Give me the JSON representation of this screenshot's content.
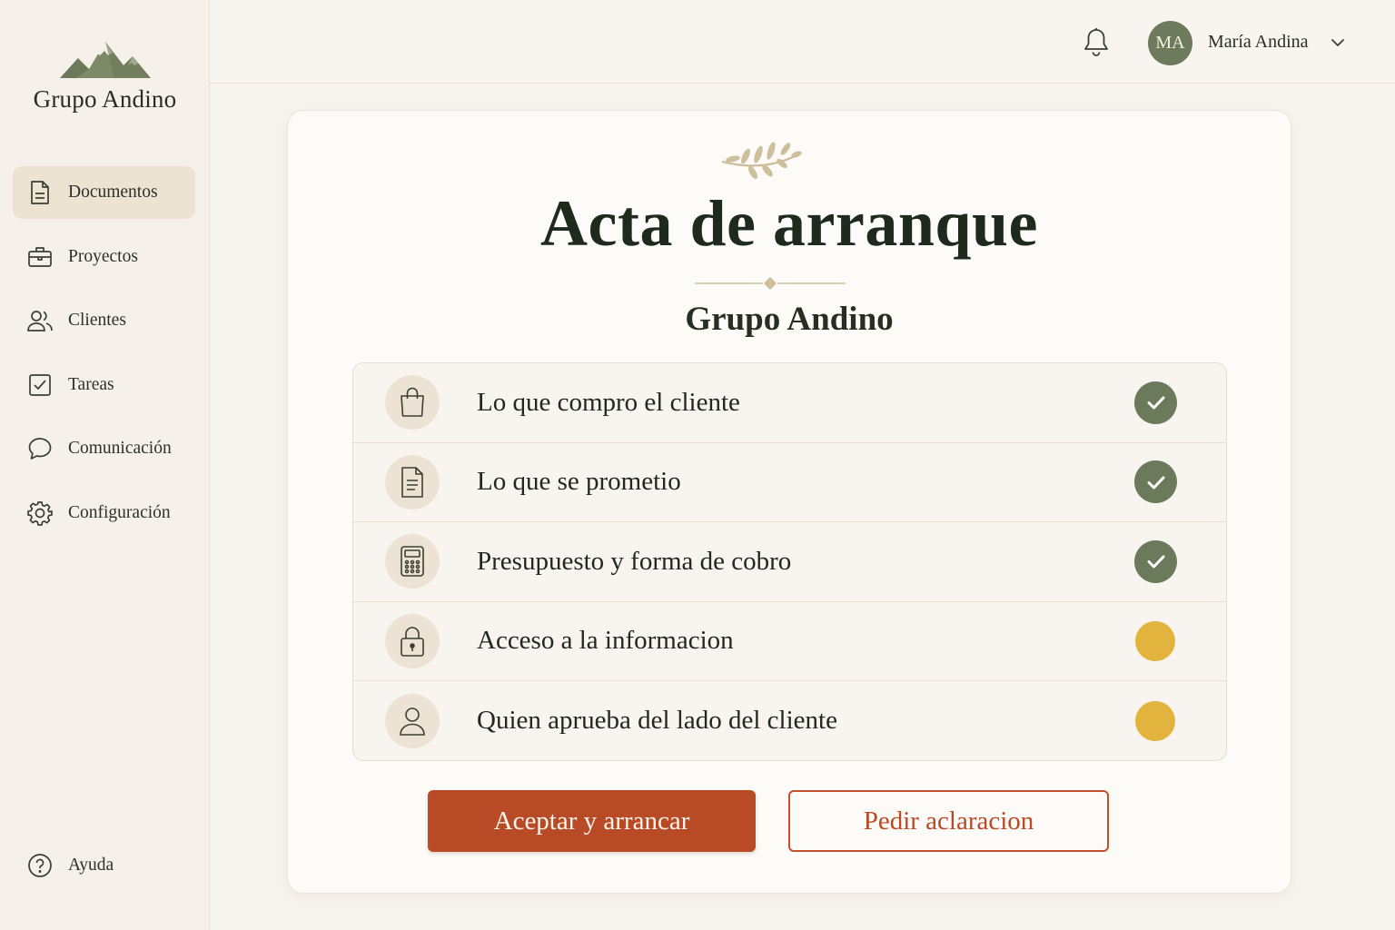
{
  "brand": {
    "name": "Grupo Andino",
    "logo_icon": "mountains-icon"
  },
  "sidebar": {
    "items": [
      {
        "label": "Documentos",
        "icon": "document-icon",
        "active": true
      },
      {
        "label": "Proyectos",
        "icon": "briefcase-icon",
        "active": false
      },
      {
        "label": "Clientes",
        "icon": "users-icon",
        "active": false
      },
      {
        "label": "Tareas",
        "icon": "checkbox-icon",
        "active": false
      },
      {
        "label": "Comunicación",
        "icon": "chat-icon",
        "active": false
      },
      {
        "label": "Configuración",
        "icon": "gear-icon",
        "active": false
      }
    ],
    "help": {
      "label": "Ayuda",
      "icon": "help-icon"
    }
  },
  "header": {
    "notifications_icon": "bell-icon",
    "user": {
      "initials": "MA",
      "name": "María Andina",
      "menu_icon": "chevron-down-icon"
    }
  },
  "document": {
    "title": "Acta de arranque",
    "subtitle": "Grupo Andino",
    "checklist": [
      {
        "label": "Lo que compro el cliente",
        "icon": "shopping-bag-icon",
        "status": "done"
      },
      {
        "label": "Lo que se prometio",
        "icon": "document-icon",
        "status": "done"
      },
      {
        "label": "Presupuesto y forma de cobro",
        "icon": "calculator-icon",
        "status": "done"
      },
      {
        "label": "Acceso a la informacion",
        "icon": "lock-icon",
        "status": "pending"
      },
      {
        "label": "Quien aprueba del lado del cliente",
        "icon": "user-icon",
        "status": "pending"
      }
    ],
    "actions": {
      "accept_label": "Aceptar y arrancar",
      "clarify_label": "Pedir aclaracion"
    }
  },
  "colors": {
    "accent": "#b94a26",
    "done": "#6a7a5b",
    "pending": "#e2b33d",
    "sidebar_active": "#ece3d3"
  }
}
